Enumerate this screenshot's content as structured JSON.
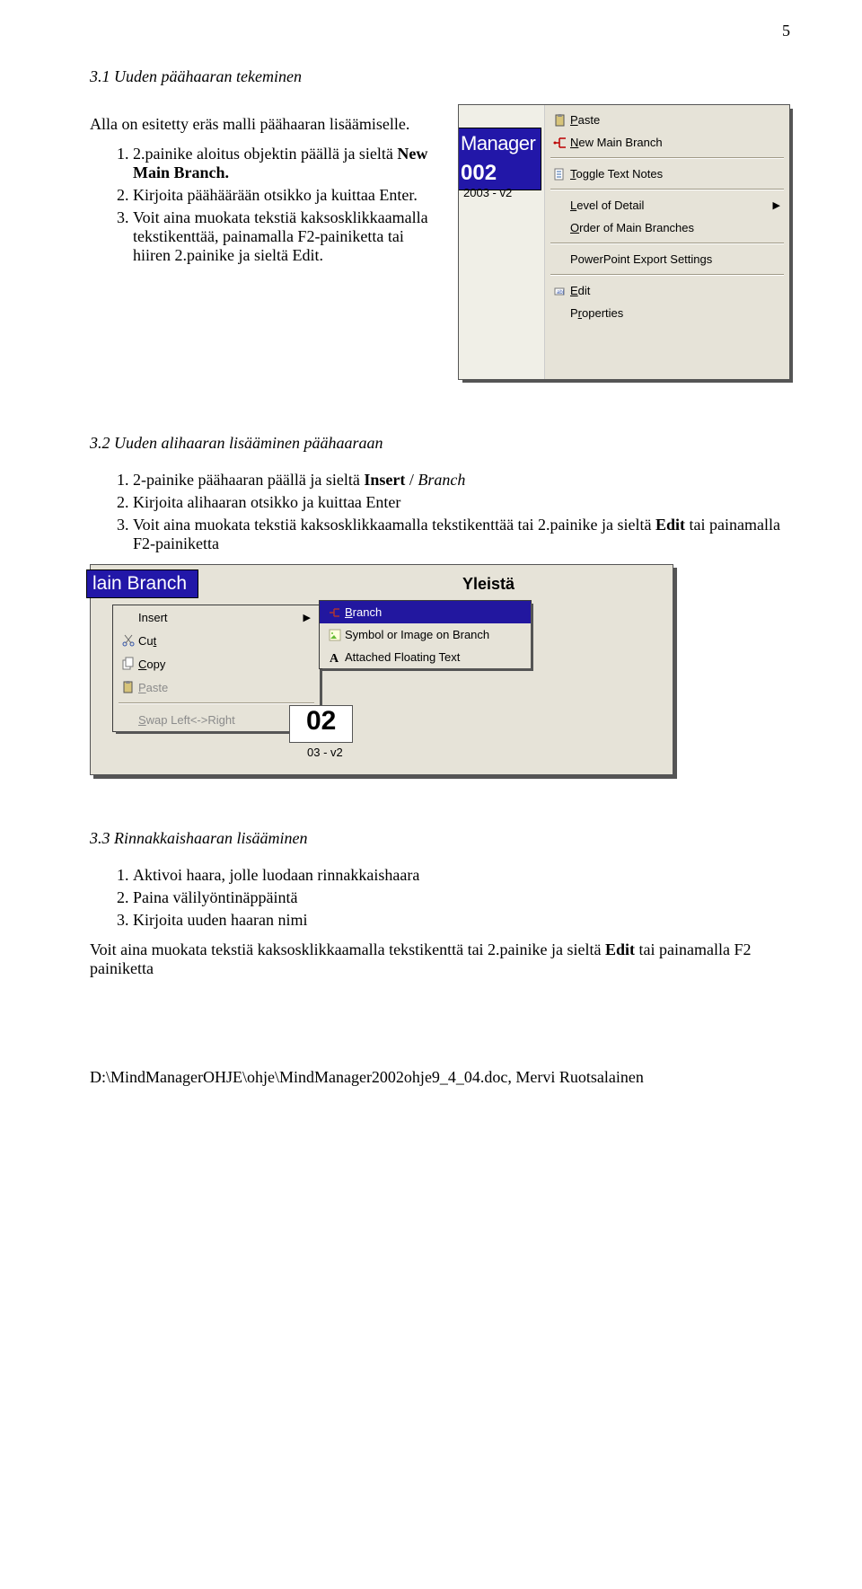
{
  "page_number": "5",
  "section31": {
    "heading": "3.1 Uuden päähaaran tekeminen",
    "intro": "Alla on esitetty eräs malli päähaaran lisäämiselle.",
    "steps_html": [
      "2.painike aloitus objektin päällä ja sieltä <b>New Main Branch.</b>",
      "Kirjoita päähäärään otsikko ja kuittaa Enter.",
      "Voit aina muokata tekstiä kaksosklikkaamalla tekstikenttää, painamalla F2-painiketta tai hiiren 2.painike ja sieltä Edit."
    ]
  },
  "screenshot1": {
    "chip_l1": "Manager",
    "chip_l2": "002",
    "subtext": "2003 - v2",
    "menu": [
      {
        "icon": "paste",
        "label": "<u>P</u>aste"
      },
      {
        "icon": "newbranch",
        "label": "<u>N</u>ew Main Branch"
      },
      {
        "sep": true
      },
      {
        "icon": "notes",
        "label": "<u>T</u>oggle Text Notes"
      },
      {
        "sep": true
      },
      {
        "icon": null,
        "label": "<u>L</u>evel of Detail",
        "arrow": true
      },
      {
        "icon": null,
        "label": "<u>O</u>rder of Main Branches"
      },
      {
        "sep": true
      },
      {
        "icon": null,
        "label": "PowerPoint Export Settings"
      },
      {
        "sep": true
      },
      {
        "icon": "edit",
        "label": "<u>E</u>dit"
      },
      {
        "icon": null,
        "label": "P<u>r</u>operties"
      }
    ]
  },
  "section32": {
    "heading": "3.2 Uuden alihaaran lisääminen päähaaraan",
    "steps_html": [
      "2-painike päähaaran päällä ja sieltä <b>Insert</b> / <i>Branch</i>",
      "Kirjoita alihaaran otsikko ja kuittaa Enter",
      "Voit aina muokata tekstiä kaksosklikkaamalla tekstikenttää tai 2.painike ja sieltä <b>Edit</b> tai painamalla F2-painiketta"
    ]
  },
  "screenshot2": {
    "chip": "lain Branch",
    "yleista": "Yleistä",
    "ctx": [
      {
        "icon": null,
        "label": "Insert",
        "arrow": true
      },
      {
        "icon": "cut",
        "label": "Cu<u>t</u>"
      },
      {
        "icon": "copy",
        "label": "<u>C</u>opy"
      },
      {
        "icon": "paste",
        "label": "<u>P</u>aste",
        "disabled": true
      },
      {
        "sep": true
      },
      {
        "icon": null,
        "label": "<u>S</u>wap Left<->Right",
        "disabled": true
      }
    ],
    "sub": [
      {
        "icon": "branch",
        "label": "<u>B</u>ranch",
        "selected": true
      },
      {
        "icon": "symbol",
        "label": "Symbol or Image on Branch"
      },
      {
        "icon": "floattext",
        "label": "Attached Floating Text"
      }
    ],
    "ohtwo": "02",
    "v2": "03 - v2"
  },
  "section33": {
    "heading": "3.3 Rinnakkaishaaran lisääminen",
    "steps_html": [
      " Aktivoi haara, jolle luodaan rinnakkaishaara",
      "Paina välilyöntinäppäintä",
      "Kirjoita uuden haaran nimi"
    ],
    "para_html": "Voit aina muokata tekstiä kaksosklikkaamalla tekstikenttä tai 2.painike ja sieltä <b>Edit</b> tai painamalla F2 painiketta"
  },
  "footer": "D:\\MindManagerOHJE\\ohje\\MindManager2002ohje9_4_04.doc, Mervi Ruotsalainen"
}
